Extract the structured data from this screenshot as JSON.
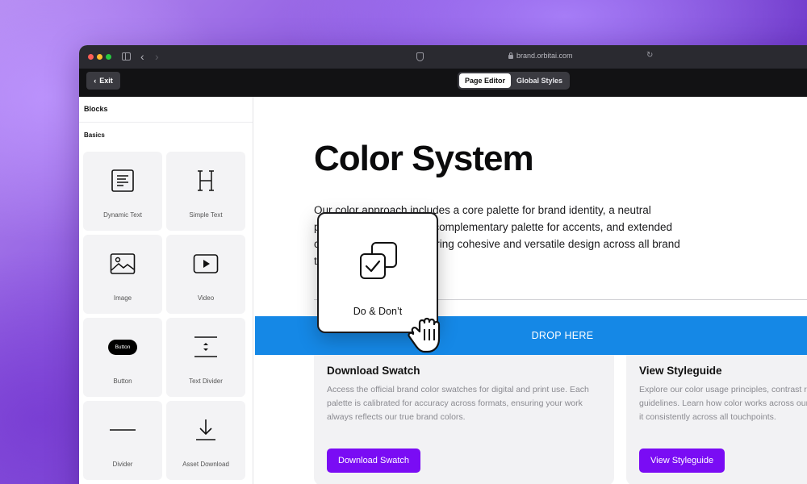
{
  "browser": {
    "url": "brand.orbitai.com",
    "traffic_light_colors": [
      "#fe5f57",
      "#febc2e",
      "#28c840"
    ]
  },
  "app_bar": {
    "exit_label": "Exit",
    "modes": [
      {
        "label": "Page Editor",
        "active": true
      },
      {
        "label": "Global Styles",
        "active": false
      }
    ]
  },
  "sidebar": {
    "title": "Blocks",
    "section": "Basics",
    "blocks": [
      {
        "label": "Dynamic Text",
        "icon": "paragraph-icon"
      },
      {
        "label": "Simple Text",
        "icon": "heading-icon"
      },
      {
        "label": "Image",
        "icon": "image-icon"
      },
      {
        "label": "Video",
        "icon": "video-icon"
      },
      {
        "label": "Button",
        "icon": "button-icon",
        "icon_text": "Button"
      },
      {
        "label": "Text Divider",
        "icon": "text-divider-icon"
      },
      {
        "label": "Divider",
        "icon": "divider-icon"
      },
      {
        "label": "Asset Download",
        "icon": "download-icon"
      }
    ]
  },
  "page": {
    "title": "Color System",
    "intro": "Our color approach includes a core palette for brand identity, a neutral palette for typography, a complementary palette for accents, and extended colors for versatility, ensuring cohesive and versatile design across all brand touchpoints.",
    "drop_zone": "DROP HERE",
    "cards": [
      {
        "title": "Download Swatch",
        "description": "Access the official brand color swatches for digital and print use. Each palette is calibrated for accuracy across formats, ensuring your work always reflects our true brand colors.",
        "button": "Download Swatch"
      },
      {
        "title": "View Styleguide",
        "description": "Explore our color usage principles, contrast ratios, and accessibility guidelines. Learn how color works across our brand and how to apply it consistently across all touchpoints.",
        "button": "View Styleguide"
      }
    ]
  },
  "dragging": {
    "label": "Do & Don’t",
    "icon": "do-dont-icon"
  },
  "colors": {
    "drop_zone": "#1588e6",
    "primary_button": "#7a0cf4"
  }
}
